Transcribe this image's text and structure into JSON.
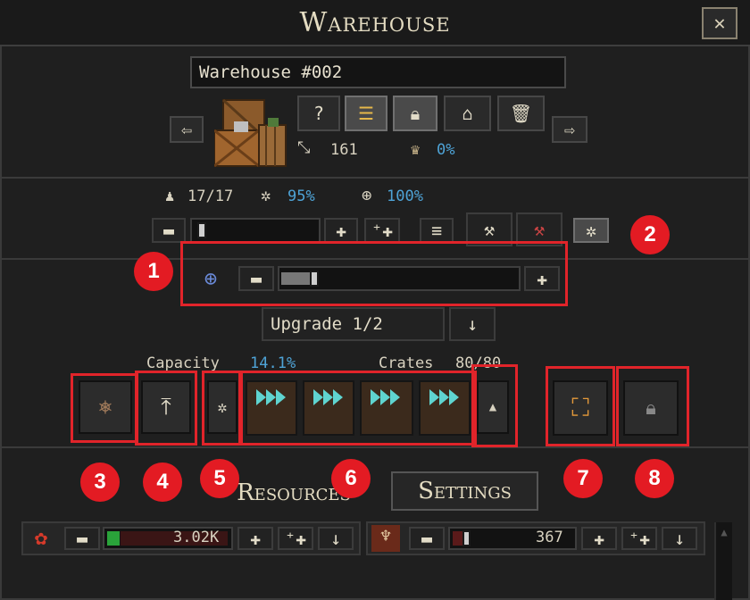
{
  "window": {
    "title": "Warehouse",
    "close_icon": "close-icon"
  },
  "warehouse": {
    "name": "Warehouse #002",
    "size": "161",
    "efficiency": "0%"
  },
  "toolbar": {
    "help": "?",
    "stats": {
      "workers": "17/17",
      "gear": "95%",
      "target": "100%"
    }
  },
  "upgrade": {
    "label": "Upgrade 1/2"
  },
  "storage": {
    "capacity_label": "Capacity",
    "capacity_value": "14.1%",
    "crates_label": "Crates",
    "crates_value": "80/80"
  },
  "tabs": {
    "resources": "Resources",
    "settings": "Settings"
  },
  "annotations": [
    "1",
    "2",
    "3",
    "4",
    "5",
    "6",
    "7",
    "8"
  ],
  "resources": [
    {
      "icon": "red-ore-icon",
      "amount": "3.02K",
      "fill": 0.1
    },
    {
      "icon": "antler-icon",
      "amount": "367",
      "fill": 0.1
    }
  ],
  "colors": {
    "highlight": "#e1242a",
    "accent": "#4ea3d6",
    "crate_arrows": "#5fd4d0"
  }
}
